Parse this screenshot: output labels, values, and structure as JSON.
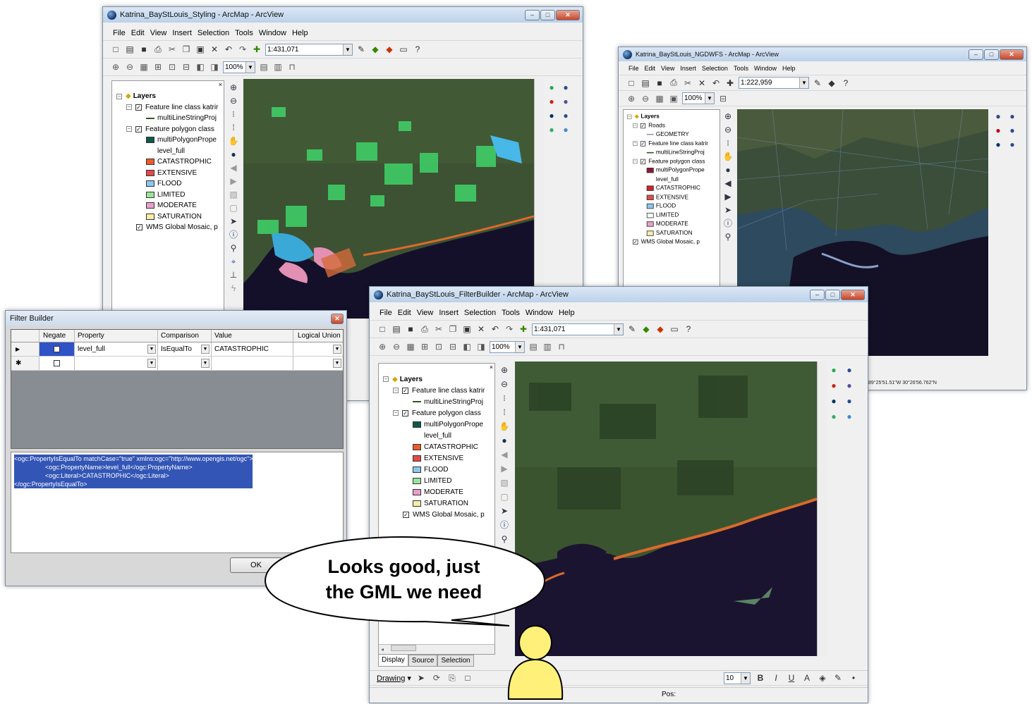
{
  "window1": {
    "title": "Katrina_BayStLouis_Styling - ArcMap - ArcView",
    "menu": [
      "File",
      "Edit",
      "View",
      "Insert",
      "Selection",
      "Tools",
      "Window",
      "Help"
    ],
    "scale": "1:431,071",
    "zoom": "100%",
    "layers": {
      "root": "Layers",
      "line_class": "Feature line class katrir",
      "line_sub": "multiLineStringProj",
      "polygon_class": "Feature polygon class",
      "polygon_sub": "multiPolygonPrope",
      "field": "level_full",
      "classes": [
        {
          "label": "CATASTROPHIC",
          "color": "#ee5a2a"
        },
        {
          "label": "EXTENSIVE",
          "color": "#e44a4a"
        },
        {
          "label": "FLOOD",
          "color": "#8ec6ee"
        },
        {
          "label": "LIMITED",
          "color": "#9be39b"
        },
        {
          "label": "MODERATE",
          "color": "#e9a0c8"
        },
        {
          "label": "SATURATION",
          "color": "#f6eea6"
        }
      ],
      "wms": "WMS Global Mosaic, p"
    }
  },
  "window2": {
    "title": "Katrina_BayStLouis_NGDWFS - ArcMap - ArcView",
    "menu": [
      "File",
      "Edit",
      "View",
      "Insert",
      "Selection",
      "Tools",
      "Window",
      "Help"
    ],
    "scale": "1:222,959",
    "zoom": "100%",
    "layers": {
      "root": "Layers",
      "roads": "Roads",
      "geometry": "GEOMETRY",
      "line_class": "Feature line class katrir",
      "line_sub": "multiLineStringProj",
      "polygon_class": "Feature polygon class",
      "polygon_sub": "multiPolygonPrope",
      "field": "level_full",
      "classes": [
        {
          "label": "CATASTROPHIC",
          "color": "#c8262a"
        },
        {
          "label": "EXTENSIVE",
          "color": "#e44a4a"
        },
        {
          "label": "FLOOD",
          "color": "#8ec6ee"
        },
        {
          "label": "LIMITED",
          "color": "#ffffff"
        },
        {
          "label": "MODERATE",
          "color": "#e9a0c8"
        },
        {
          "label": "SATURATION",
          "color": "#f6eea6"
        }
      ],
      "wms": "WMS Global Mosaic, p"
    },
    "status_coords": "89°25'51.51\"W 30°26'56.762\"N"
  },
  "window3": {
    "title": "Katrina_BayStLouis_FilterBuilder - ArcMap - ArcView",
    "menu": [
      "File",
      "Edit",
      "View",
      "Insert",
      "Selection",
      "Tools",
      "Window",
      "Help"
    ],
    "scale": "1:431,071",
    "zoom": "100%",
    "layers": {
      "root": "Layers",
      "line_class": "Feature line class katrir",
      "line_sub": "multiLineStringProj",
      "polygon_class": "Feature polygon class",
      "polygon_sub": "multiPolygonPrope",
      "field": "level_full",
      "classes": [
        {
          "label": "CATASTROPHIC",
          "color": "#ee5a2a"
        },
        {
          "label": "EXTENSIVE",
          "color": "#e44a4a"
        },
        {
          "label": "FLOOD",
          "color": "#8ec6ee"
        },
        {
          "label": "LIMITED",
          "color": "#9be39b"
        },
        {
          "label": "MODERATE",
          "color": "#e9a0c8"
        },
        {
          "label": "SATURATION",
          "color": "#f6eea6"
        }
      ],
      "wms": "WMS Global Mosaic, p"
    },
    "toc_tabs": [
      "Display",
      "Source",
      "Selection"
    ],
    "drawing_label": "Drawing",
    "font_size": "10",
    "status_pos": "Pos:"
  },
  "filter_builder": {
    "title": "Filter Builder",
    "columns": [
      "Negate",
      "Property",
      "Comparison",
      "Value",
      "Logical Union"
    ],
    "rows": [
      {
        "property": "level_full",
        "comparison": "IsEqualTo",
        "value": "CATASTROPHIC",
        "union": ""
      }
    ],
    "xml_lines": [
      "<ogc:PropertyIsEqualTo matchCase=\"true\" xmlns:ogc=\"http://www.opengis.net/ogc\">",
      "<ogc:PropertyName>level_full</ogc:PropertyName>",
      "<ogc:Literal>CATASTROPHIC</ogc:Literal>",
      "</ogc:PropertyIsEqualTo>"
    ],
    "ok_label": "OK"
  },
  "speech": {
    "line1": "Looks good, just",
    "line2": "the GML we need"
  },
  "colors": {
    "ocean": "#1b1430",
    "land": "#3b5430",
    "highlight": "#ffd400"
  }
}
